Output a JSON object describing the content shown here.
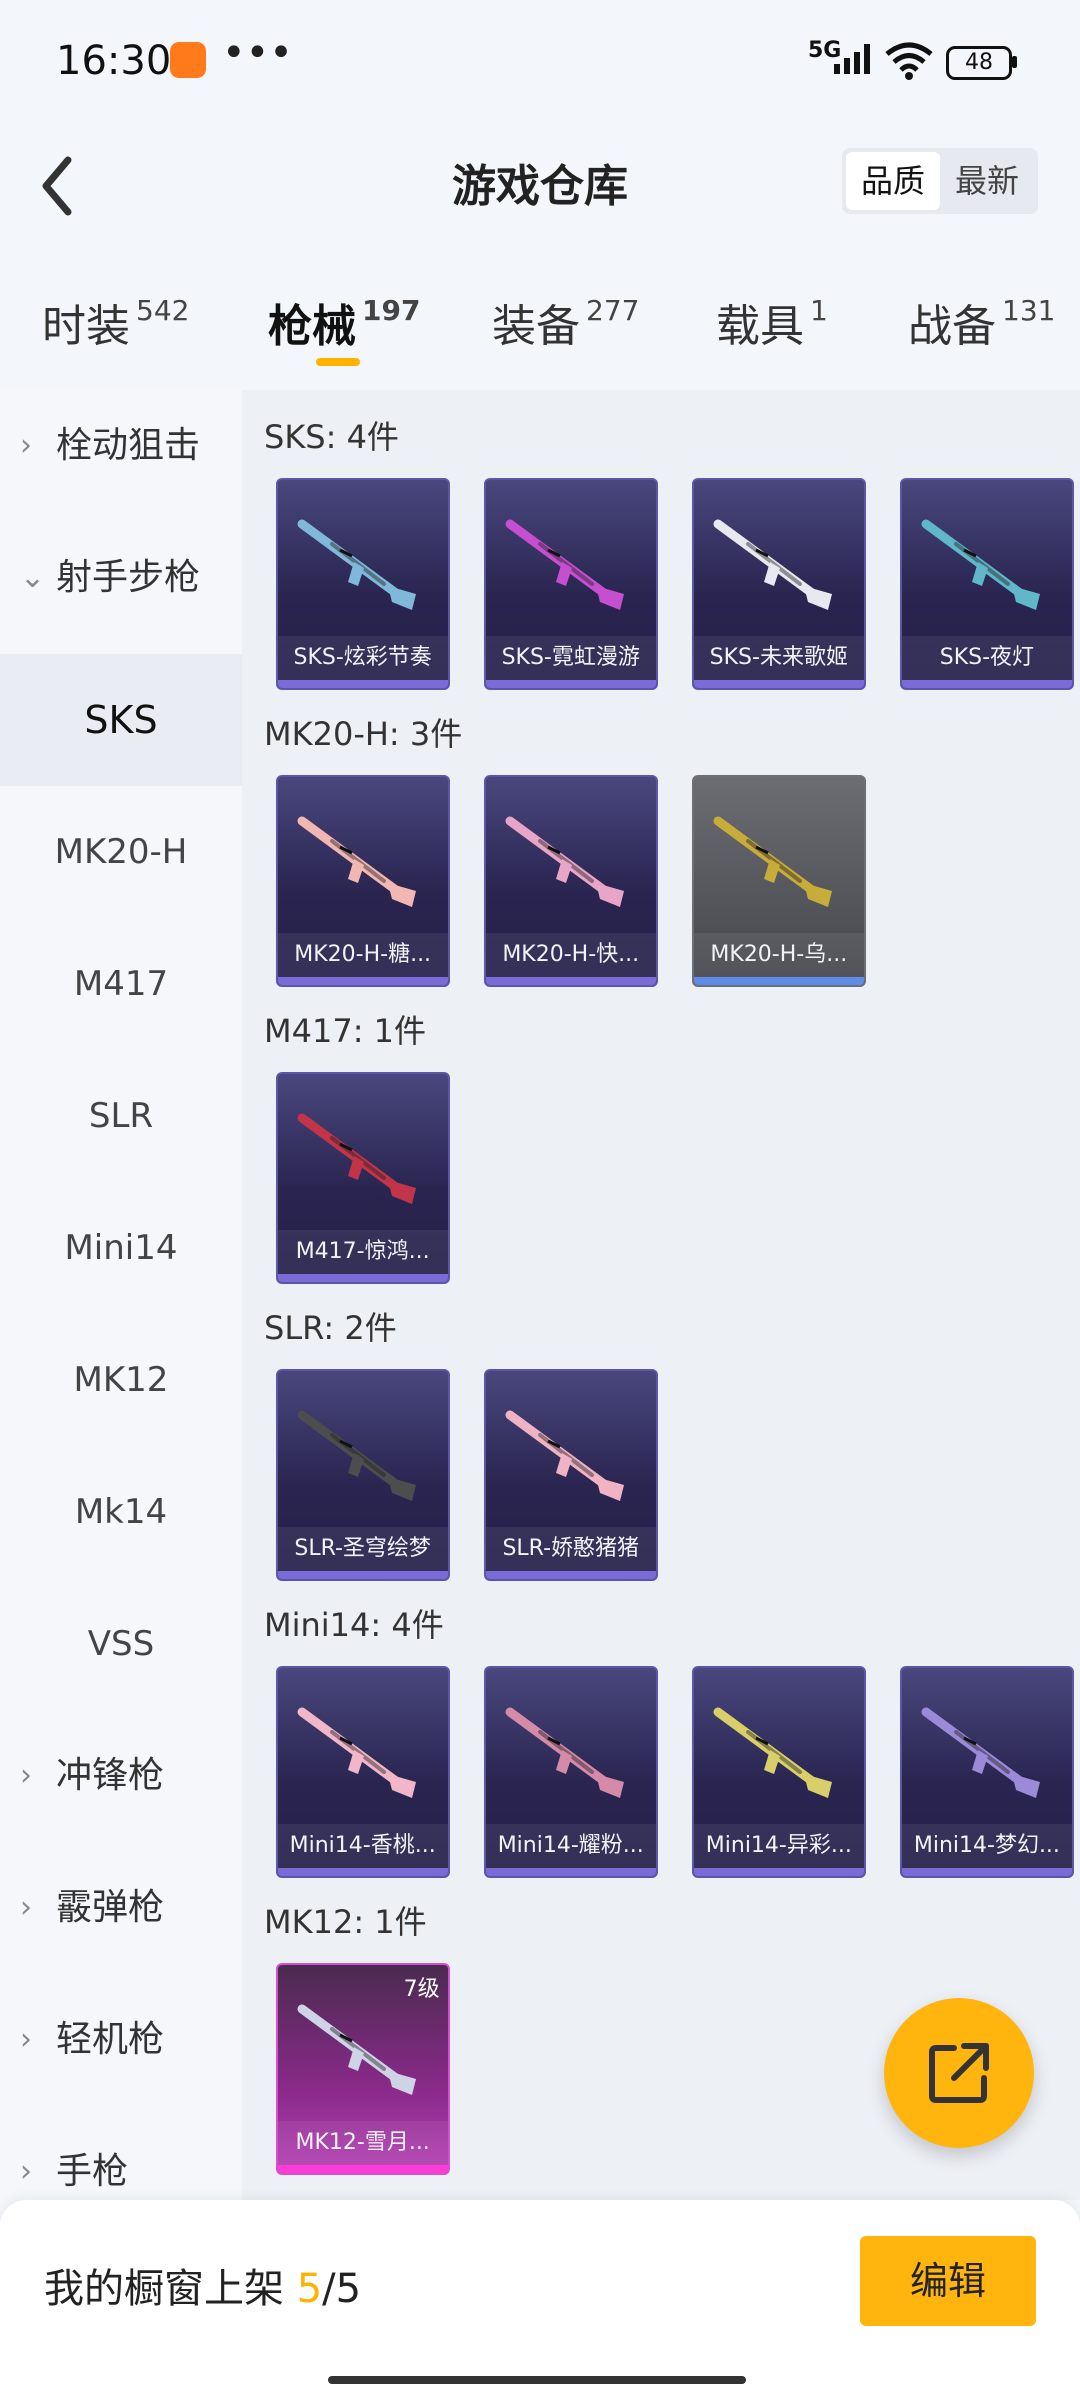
{
  "status_bar": {
    "time": "16:30",
    "network": "5G",
    "battery": "48",
    "dots": "•••"
  },
  "header": {
    "title": "游戏仓库",
    "sort_options": [
      "品质",
      "最新"
    ],
    "active_sort": "品质"
  },
  "tabs": [
    {
      "label": "时装",
      "count": "542"
    },
    {
      "label": "枪械",
      "count": "197"
    },
    {
      "label": "装备",
      "count": "277"
    },
    {
      "label": "载具",
      "count": "1"
    },
    {
      "label": "战备",
      "count": "131"
    }
  ],
  "active_tab": "枪械",
  "sidebar": {
    "items": [
      {
        "label": "栓动狙击",
        "type": "category",
        "expanded": false
      },
      {
        "label": "射手步枪",
        "type": "category",
        "expanded": true
      },
      {
        "label": "SKS",
        "type": "sub",
        "selected": true
      },
      {
        "label": "MK20-H",
        "type": "sub"
      },
      {
        "label": "M417",
        "type": "sub"
      },
      {
        "label": "SLR",
        "type": "sub"
      },
      {
        "label": "Mini14",
        "type": "sub"
      },
      {
        "label": "MK12",
        "type": "sub"
      },
      {
        "label": "Mk14",
        "type": "sub"
      },
      {
        "label": "VSS",
        "type": "sub"
      },
      {
        "label": "冲锋枪",
        "type": "category",
        "expanded": false
      },
      {
        "label": "霰弹枪",
        "type": "category",
        "expanded": false
      },
      {
        "label": "轻机枪",
        "type": "category",
        "expanded": false
      },
      {
        "label": "手枪",
        "type": "category",
        "expanded": false
      }
    ]
  },
  "groups": [
    {
      "title": "SKS: 4件",
      "items": [
        {
          "name": "SKS-炫彩节奏",
          "rarity": "purple",
          "gun_color": "#7fb8d8"
        },
        {
          "name": "SKS-霓虹漫游",
          "rarity": "purple",
          "gun_color": "#c64fd0"
        },
        {
          "name": "SKS-未来歌姬",
          "rarity": "purple",
          "gun_color": "#e8e8f0"
        },
        {
          "name": "SKS-夜灯",
          "rarity": "purple",
          "gun_color": "#5fb7c9"
        }
      ]
    },
    {
      "title": "MK20-H: 3件",
      "items": [
        {
          "name": "MK20-H-糖...",
          "rarity": "purple",
          "gun_color": "#f3b7b3"
        },
        {
          "name": "MK20-H-快...",
          "rarity": "purple",
          "gun_color": "#e8a5c8"
        },
        {
          "name": "MK20-H-乌...",
          "rarity": "gray",
          "gun_color": "#c8ac3a"
        }
      ]
    },
    {
      "title": "M417: 1件",
      "items": [
        {
          "name": "M417-惊鸿...",
          "rarity": "purple",
          "gun_color": "#c23548"
        }
      ]
    },
    {
      "title": "SLR: 2件",
      "items": [
        {
          "name": "SLR-圣穹绘梦",
          "rarity": "purple",
          "gun_color": "#4d4d4d"
        },
        {
          "name": "SLR-娇憨猪猪",
          "rarity": "purple",
          "gun_color": "#f0b3c4"
        }
      ]
    },
    {
      "title": "Mini14: 4件",
      "items": [
        {
          "name": "Mini14-香桃...",
          "rarity": "purple",
          "gun_color": "#f2b6c9"
        },
        {
          "name": "Mini14-耀粉...",
          "rarity": "purple",
          "gun_color": "#d58aa8"
        },
        {
          "name": "Mini14-异彩...",
          "rarity": "purple",
          "gun_color": "#d9cf6a"
        },
        {
          "name": "Mini14-梦幻...",
          "rarity": "purple",
          "gun_color": "#9b8ad8"
        }
      ]
    },
    {
      "title": "MK12: 1件",
      "items": [
        {
          "name": "MK12-雪月...",
          "rarity": "pink",
          "gun_color": "#cfd3e6",
          "level": "7级"
        }
      ]
    }
  ],
  "bottom_bar": {
    "shelf_label": "我的橱窗上架",
    "shelf_current": "5",
    "shelf_total": "/5",
    "edit_label": "编辑"
  },
  "colors": {
    "accent": "#ffb300",
    "card_purple": "#2a2550",
    "card_pink": "#b43fb4",
    "card_gray": "#44464c"
  }
}
